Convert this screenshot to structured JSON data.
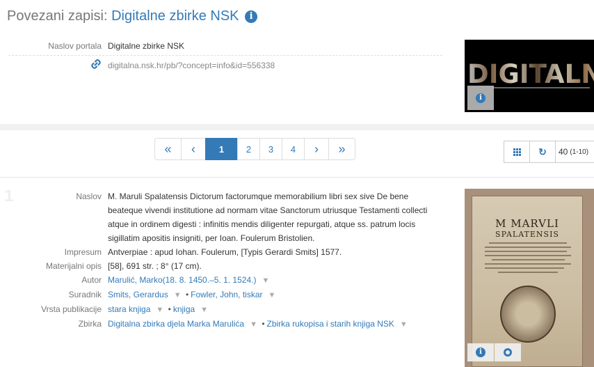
{
  "header": {
    "prefix": "Povezani zapisi:",
    "title": "Digitalne zbirke NSK",
    "info_icon": "i"
  },
  "portal": {
    "label": "Naslov portala",
    "value": "Digitalne zbirke NSK",
    "url": "digitalna.nsk.hr/pb/?concept=info&id=556338",
    "link_icon": "link-icon"
  },
  "thumb_digitalna": {
    "logo_text": "DIGITALNA",
    "info_icon": "i"
  },
  "pagination": {
    "first": "«",
    "prev": "‹",
    "pages": [
      "1",
      "2",
      "3",
      "4"
    ],
    "active": "1",
    "next": "›",
    "last": "»"
  },
  "toolbar": {
    "grid_icon": "grid-icon",
    "refresh_icon": "↻",
    "count": "40",
    "range": "(1-10)"
  },
  "record": {
    "number": "1",
    "naslov_label": "Naslov",
    "naslov": "M. Maruli Spalatensis Dictorum factorumque memorabilium libri sex sive De bene beateque vivendi institutione ad normam vitae Sanctorum utriusque Testamenti collecti atque in ordinem digesti : infinitis mendis diligenter repurgati, atque ss. patrum locis sigillatim apositis insigniti, per Ioan. Foulerum Bristolien.",
    "impresum_label": "Impresum",
    "impresum": "Antverpiae : apud Iohan. Foulerum, [Typis Gerardi Smits] 1577.",
    "opis_label": "Materijalni opis",
    "opis": "[58], 691 str. ; 8° (17 cm).",
    "autor_label": "Autor",
    "autor": "Marulić, Marko(18. 8. 1450.–5. 1. 1524.)",
    "suradnik_label": "Suradnik",
    "suradnik": [
      "Smits, Gerardus",
      "Fowler, John, tiskar"
    ],
    "vrsta_label": "Vrsta publikacije",
    "vrsta": [
      "stara knjiga",
      "knjiga"
    ],
    "zbirka_label": "Zbirka",
    "zbirka": [
      "Digitalna zbirka djela Marka Marulića",
      "Zbirka rukopisa i starih knjiga NSK"
    ],
    "separator": "•",
    "filter_icon": "filter-icon"
  },
  "thumb_book": {
    "title_line1": "M MARVLI",
    "title_line2": "SPALATENSIS",
    "info_icon": "i",
    "view_icon": "target-icon"
  }
}
